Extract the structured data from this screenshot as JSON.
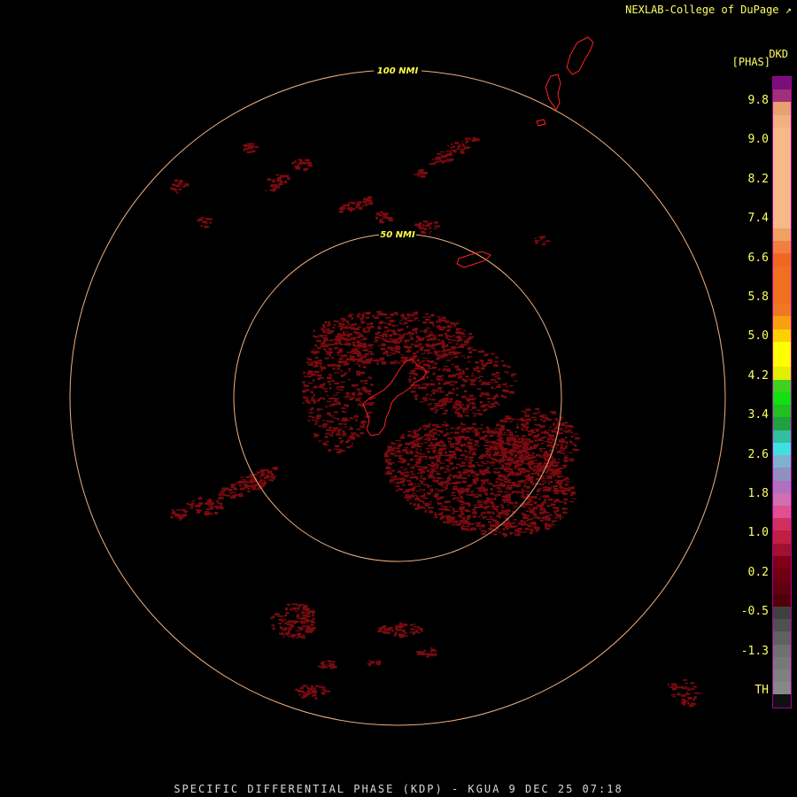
{
  "header": {
    "credit": "NEXLAB-College of DuPage",
    "credit_icon": "external-link-icon"
  },
  "product": {
    "title": "SPECIFIC DIFFERENTIAL PHASE (KDP) - KGUA 9 DEC 25 07:18"
  },
  "legend": {
    "unit_top": "DKD",
    "unit_sub": "[PHAS]",
    "labels": [
      "9.8",
      "9.0",
      "8.2",
      "7.4",
      "6.6",
      "5.8",
      "5.0",
      "4.2",
      "3.4",
      "2.6",
      "1.8",
      "1.0",
      "0.2",
      "-0.5",
      "-1.3",
      "TH"
    ],
    "colors": [
      "#7a0f7a",
      "#a0307a",
      "#e8a070",
      "#f0b080",
      "#f8b888",
      "#f8b888",
      "#f8b888",
      "#f8b888",
      "#f8b888",
      "#f8b888",
      "#f8b888",
      "#f8b888",
      "#f0a060",
      "#f08040",
      "#f06820",
      "#f07020",
      "#f07020",
      "#f07020",
      "#f07820",
      "#f8a010",
      "#ffd000",
      "#ffff00",
      "#ffff00",
      "#e0f000",
      "#40d020",
      "#10e010",
      "#20c020",
      "#20a040",
      "#30c0a0",
      "#40e0e0",
      "#80b0d0",
      "#9090c0",
      "#b070c0",
      "#d070b0",
      "#e05090",
      "#d03060",
      "#c02040",
      "#a01030",
      "#800018",
      "#700010",
      "#600010",
      "#500008",
      "#404040",
      "#505050",
      "#606060",
      "#707070",
      "#787878",
      "#808080",
      "#888888",
      "#101010"
    ]
  },
  "range_rings": [
    {
      "label": "50 NMI"
    },
    {
      "label": "100 NMI"
    }
  ],
  "colors": {
    "ring": "#f0b080",
    "echo": "#7a0b10",
    "coast": "#ff2020",
    "text": "#ffff66"
  }
}
